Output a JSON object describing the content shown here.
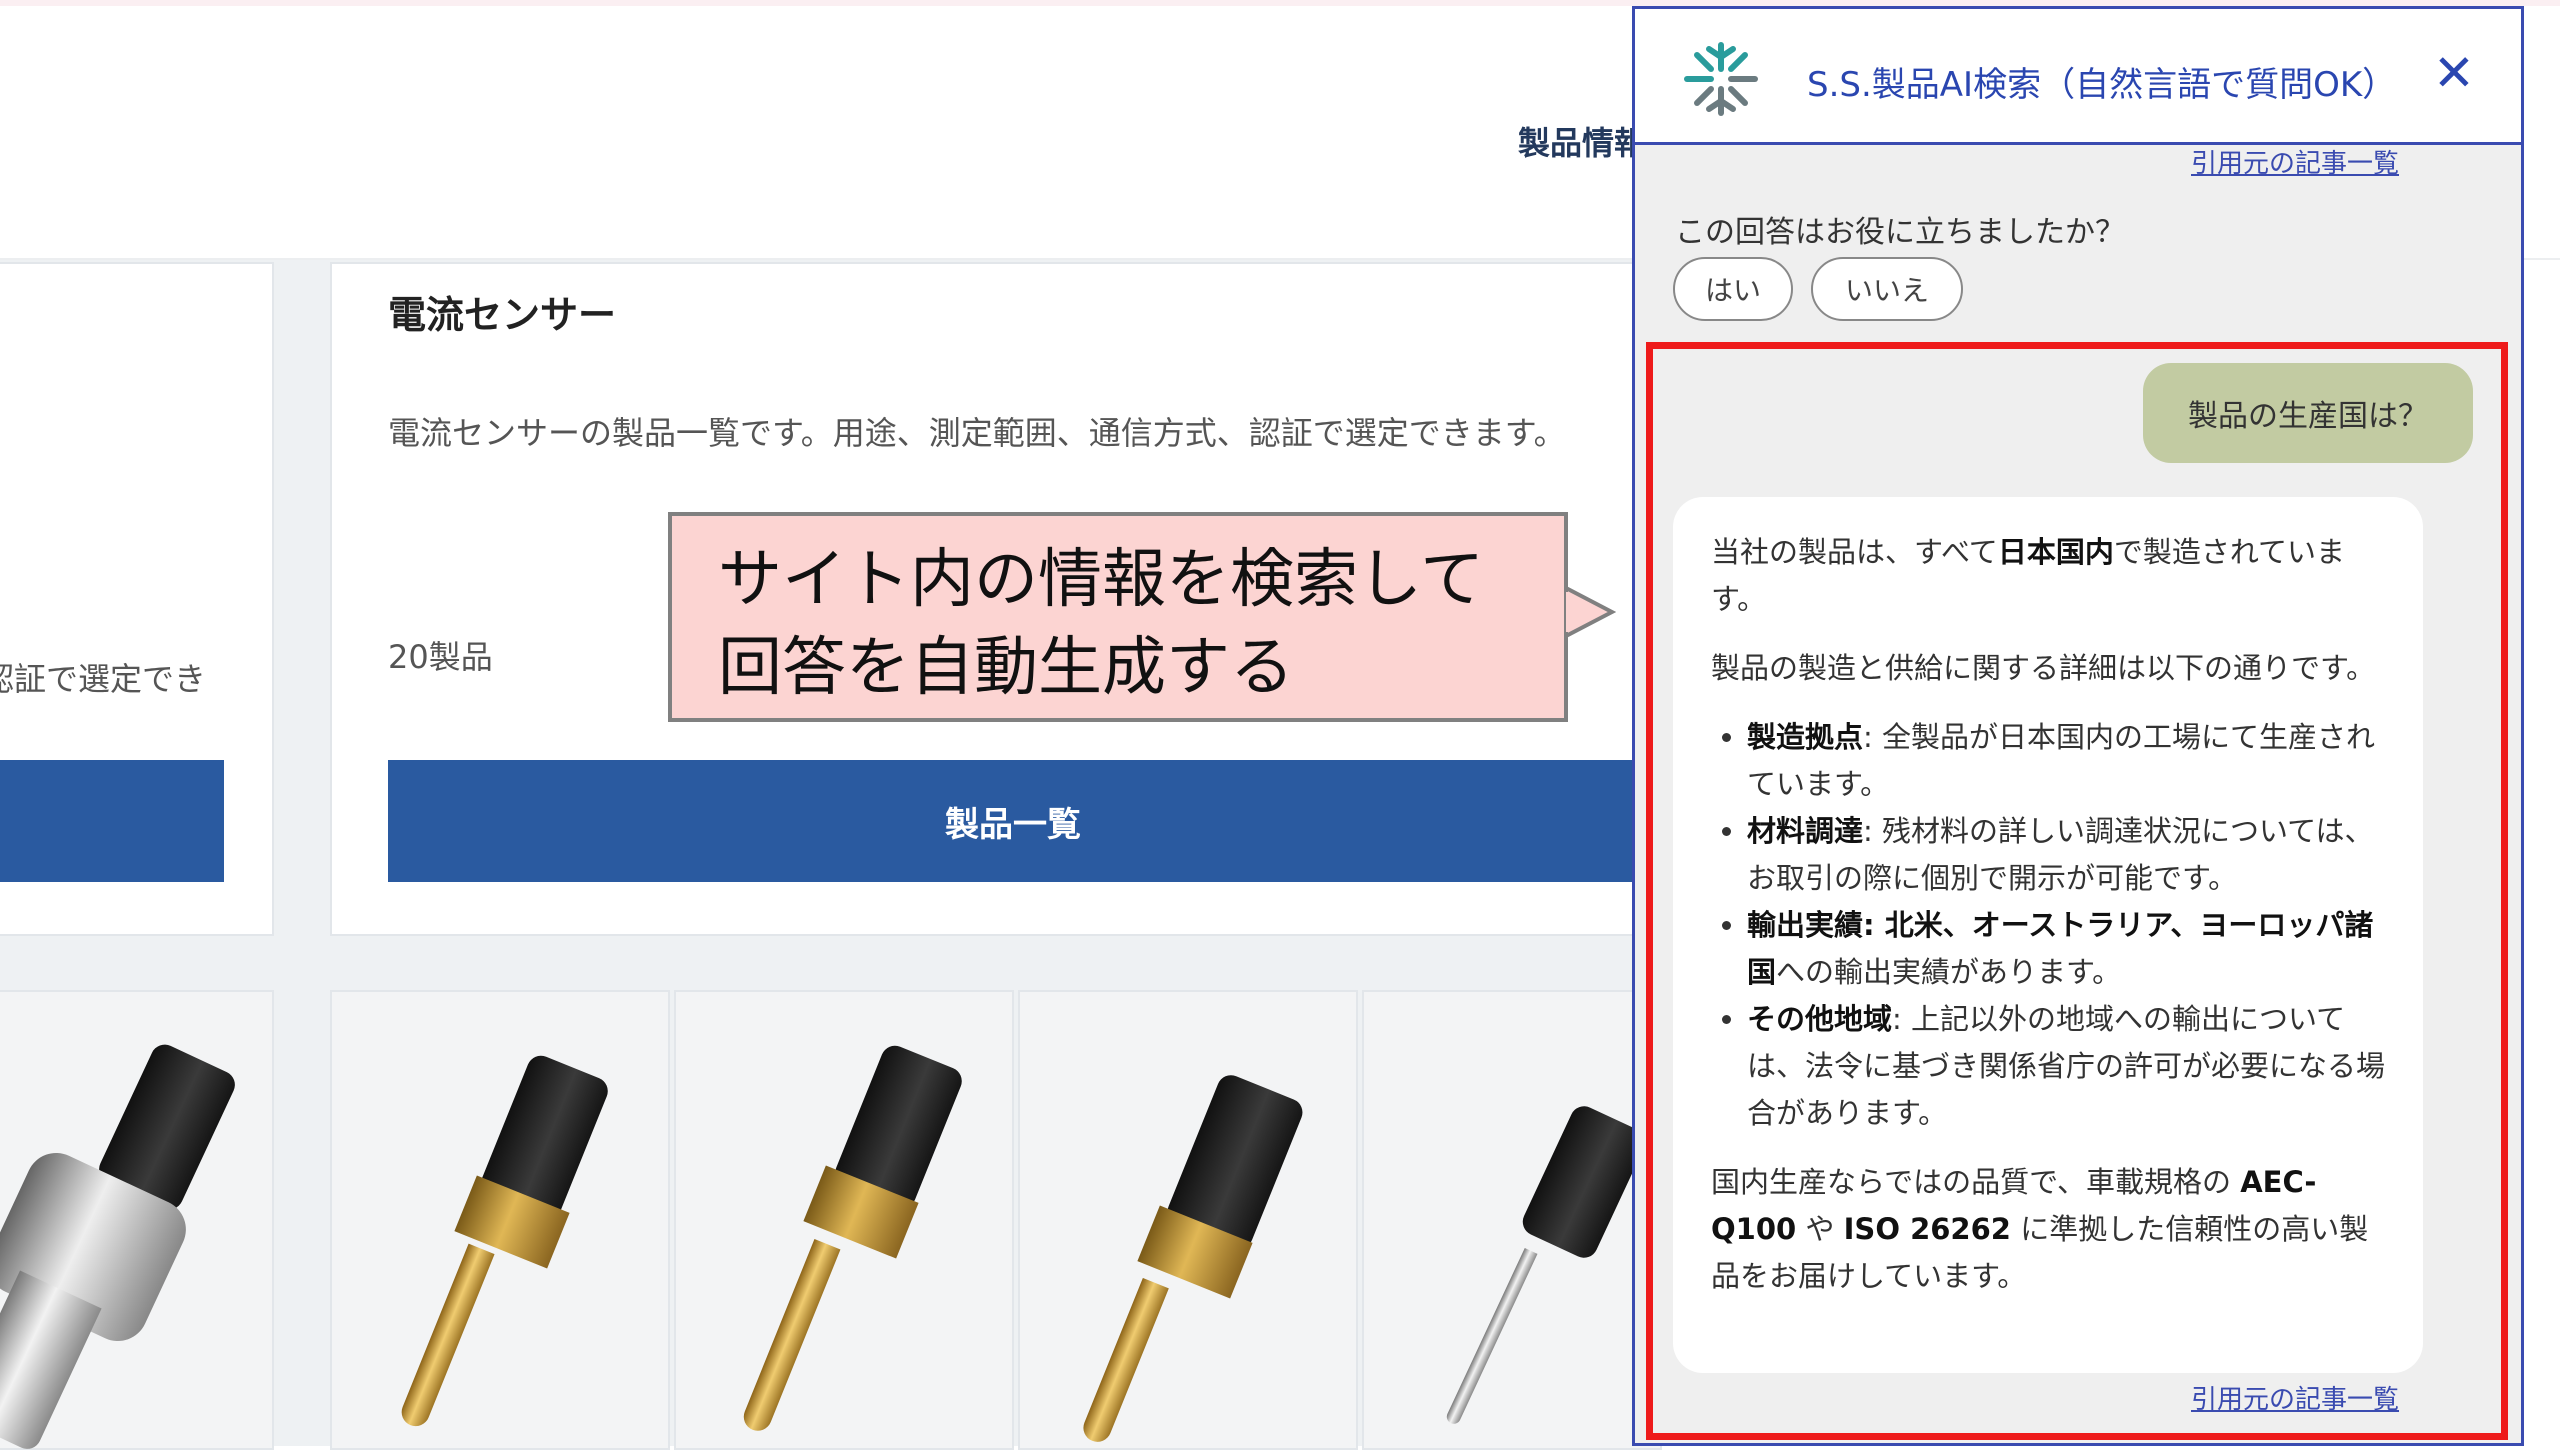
{
  "header": {
    "nav_label": "製品情報"
  },
  "left_card": {
    "desc_fragment": "認証で選定でき"
  },
  "product_card": {
    "title": "電流センサー",
    "description": "電流センサーの製品一覧です。用途、測定範囲、通信方式、認証で選定できます。",
    "count": "20製品",
    "button_label": "製品一覧"
  },
  "callout": {
    "line1": "サイト内の情報を検索して",
    "line2": "回答を自動生成する"
  },
  "chat": {
    "title": "S.S.製品AI検索（自然言語で質問OK）",
    "close_icon": "close-icon",
    "logo_icon": "snowflake-logo-icon",
    "colors": {
      "accent": "#2a46b0",
      "logo_teal": "#2a9c9c",
      "logo_gray": "#6b7b80",
      "user_bubble": "#c2cba2",
      "highlight": "#ee1b1b"
    },
    "cite_link": "引用元の記事一覧",
    "feedback_question": "この回答はお役に立ちましたか？",
    "feedback_yes": "はい",
    "feedback_no": "いいえ",
    "user_message": "製品の生産国は？",
    "answer": {
      "p1_pre": "当社の製品は、すべて",
      "p1_bold": "日本国内",
      "p1_post": "で製造されています。",
      "p2": "製品の製造と供給に関する詳細は以下の通りです。",
      "bullets": [
        {
          "label": "製造拠点",
          "text": ": 全製品が日本国内の工場にて生産されています。"
        },
        {
          "label": "材料調達",
          "text": ": 残材料の詳しい調達状況については、お取引の際に個別で開示が可能です。"
        },
        {
          "label": "輸出実績",
          "bold_text": ": 北米、オーストラリア、ヨーロッパ諸国",
          "text": "への輸出実績があります。"
        },
        {
          "label": "その他地域",
          "text": ": 上記以外の地域への輸出については、法令に基づき関係省庁の許可が必要になる場合があります。"
        }
      ],
      "p3_pre": "国内生産ならではの品質で、車載規格の",
      "p3_bold1": "AEC-Q100",
      "p3_mid": "や",
      "p3_bold2": "ISO 26262",
      "p3_post": "に準拠した信頼性の高い製品をお届けしています。"
    }
  }
}
